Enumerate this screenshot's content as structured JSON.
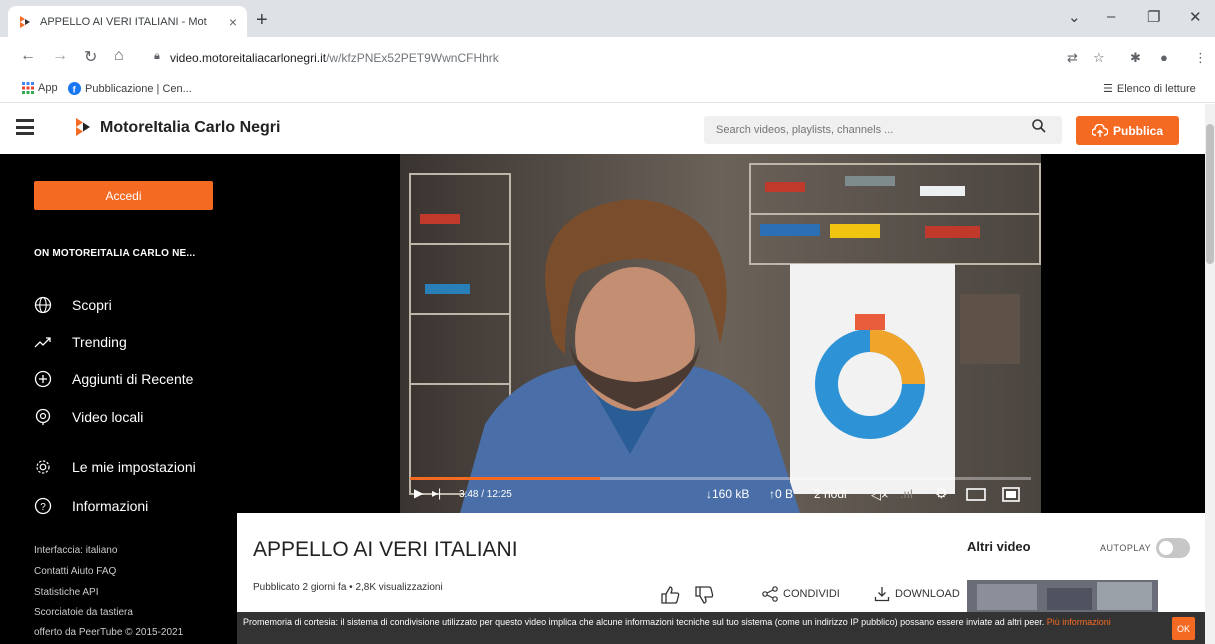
{
  "browser": {
    "tab_title": "APPELLO AI VERI ITALIANI - Mot",
    "tab_close": "×",
    "new_tab": "+",
    "url_domain": "video.motoreitaliacarlonegri.it",
    "url_path": "/w/kfzPNEx52PET9WwnCFHhrk",
    "bookmarks": [
      {
        "label": "App",
        "icon": "apps-grid-icon"
      },
      {
        "label": "Pubblicazione | Cen...",
        "icon": "facebook-icon"
      }
    ],
    "reading_list": "Elenco di letture",
    "window_controls": [
      "⌄",
      "–",
      "❐",
      "✕"
    ]
  },
  "site": {
    "name": "MotoreItalia Carlo Negri",
    "search_placeholder": "Search videos, playlists, channels ...",
    "publish_label": "Pubblica",
    "accent_color": "#f56a23"
  },
  "sidebar": {
    "login_label": "Accedi",
    "channel_heading": "ON MOTOREITALIA CARLO NE...",
    "items": [
      {
        "label": "Scopri",
        "icon": "globe-icon"
      },
      {
        "label": "Trending",
        "icon": "trending-icon"
      },
      {
        "label": "Aggiunti di Recente",
        "icon": "plus-circle-icon"
      },
      {
        "label": "Video locali",
        "icon": "location-pin-icon"
      },
      {
        "label": "Le mie impostazioni",
        "icon": "gear-icon"
      },
      {
        "label": "Informazioni",
        "icon": "help-circle-icon"
      }
    ],
    "footer": [
      "Interfaccia: italiano",
      "Contatti  Aiuto  FAQ",
      "Statistiche  API",
      "Scorciatoie da tastiera",
      "offerto da PeerTube © 2015-2021"
    ]
  },
  "player": {
    "time": "3:48 / 12:25",
    "download_rate": "↓160 kB",
    "upload_rate": "↑0 B",
    "peers": "2 nodi",
    "progress": 0.306
  },
  "video": {
    "title": "APPELLO AI VERI ITALIANI",
    "meta": "Pubblicato 2 giorni fa • 2,8K visualizzazioni",
    "share_label": "CONDIVIDI",
    "download_label": "DOWNLOAD"
  },
  "related": {
    "heading": "Altri video",
    "autoplay_label": "AUTOPLAY"
  },
  "cookie": {
    "text": "Promemoria di cortesia: il sistema di condivisione utilizzato per questo video implica che alcune informazioni tecniche sul tuo sistema (come un indirizzo IP pubblico) possano essere inviate ad altri peer.",
    "more_label": "Più informazioni",
    "ok_label": "OK"
  }
}
